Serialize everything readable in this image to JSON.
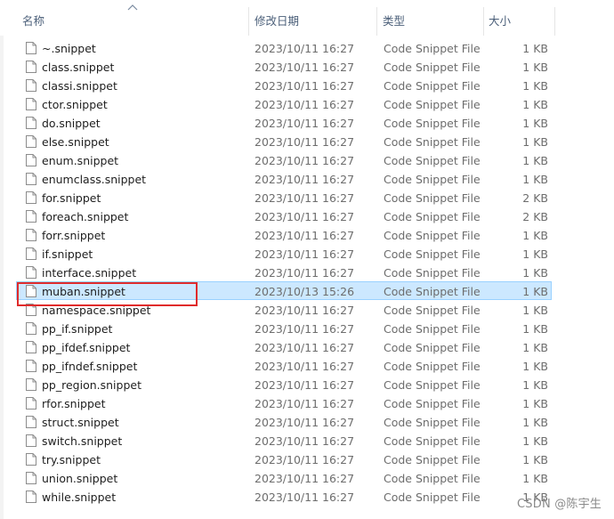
{
  "columns": {
    "name": "名称",
    "date": "修改日期",
    "type": "类型",
    "size": "大小"
  },
  "files": [
    {
      "name": "~.snippet",
      "date": "2023/10/11 16:27",
      "type": "Code Snippet File",
      "size": "1 KB"
    },
    {
      "name": "class.snippet",
      "date": "2023/10/11 16:27",
      "type": "Code Snippet File",
      "size": "1 KB"
    },
    {
      "name": "classi.snippet",
      "date": "2023/10/11 16:27",
      "type": "Code Snippet File",
      "size": "1 KB"
    },
    {
      "name": "ctor.snippet",
      "date": "2023/10/11 16:27",
      "type": "Code Snippet File",
      "size": "1 KB"
    },
    {
      "name": "do.snippet",
      "date": "2023/10/11 16:27",
      "type": "Code Snippet File",
      "size": "1 KB"
    },
    {
      "name": "else.snippet",
      "date": "2023/10/11 16:27",
      "type": "Code Snippet File",
      "size": "1 KB"
    },
    {
      "name": "enum.snippet",
      "date": "2023/10/11 16:27",
      "type": "Code Snippet File",
      "size": "1 KB"
    },
    {
      "name": "enumclass.snippet",
      "date": "2023/10/11 16:27",
      "type": "Code Snippet File",
      "size": "1 KB"
    },
    {
      "name": "for.snippet",
      "date": "2023/10/11 16:27",
      "type": "Code Snippet File",
      "size": "2 KB"
    },
    {
      "name": "foreach.snippet",
      "date": "2023/10/11 16:27",
      "type": "Code Snippet File",
      "size": "2 KB"
    },
    {
      "name": "forr.snippet",
      "date": "2023/10/11 16:27",
      "type": "Code Snippet File",
      "size": "1 KB"
    },
    {
      "name": "if.snippet",
      "date": "2023/10/11 16:27",
      "type": "Code Snippet File",
      "size": "1 KB"
    },
    {
      "name": "interface.snippet",
      "date": "2023/10/11 16:27",
      "type": "Code Snippet File",
      "size": "1 KB"
    },
    {
      "name": "muban.snippet",
      "date": "2023/10/13 15:26",
      "type": "Code Snippet File",
      "size": "1 KB",
      "selected": true
    },
    {
      "name": "namespace.snippet",
      "date": "2023/10/11 16:27",
      "type": "Code Snippet File",
      "size": "1 KB"
    },
    {
      "name": "pp_if.snippet",
      "date": "2023/10/11 16:27",
      "type": "Code Snippet File",
      "size": "1 KB"
    },
    {
      "name": "pp_ifdef.snippet",
      "date": "2023/10/11 16:27",
      "type": "Code Snippet File",
      "size": "1 KB"
    },
    {
      "name": "pp_ifndef.snippet",
      "date": "2023/10/11 16:27",
      "type": "Code Snippet File",
      "size": "1 KB"
    },
    {
      "name": "pp_region.snippet",
      "date": "2023/10/11 16:27",
      "type": "Code Snippet File",
      "size": "1 KB"
    },
    {
      "name": "rfor.snippet",
      "date": "2023/10/11 16:27",
      "type": "Code Snippet File",
      "size": "1 KB"
    },
    {
      "name": "struct.snippet",
      "date": "2023/10/11 16:27",
      "type": "Code Snippet File",
      "size": "1 KB"
    },
    {
      "name": "switch.snippet",
      "date": "2023/10/11 16:27",
      "type": "Code Snippet File",
      "size": "1 KB"
    },
    {
      "name": "try.snippet",
      "date": "2023/10/11 16:27",
      "type": "Code Snippet File",
      "size": "1 KB"
    },
    {
      "name": "union.snippet",
      "date": "2023/10/11 16:27",
      "type": "Code Snippet File",
      "size": "1 KB"
    },
    {
      "name": "while.snippet",
      "date": "2023/10/11 16:27",
      "type": "Code Snippet File",
      "size": "1 KB"
    }
  ],
  "watermark": "CSDN @陈宇生",
  "colors": {
    "selected_bg": "#cce8ff",
    "selected_border": "#99d1ff",
    "highlight_box": "#e02b2b",
    "header_text": "#4c607a",
    "detail_text": "#6d6d6d"
  },
  "icons": {
    "sort": "sort-ascending-icon",
    "file": "file-icon"
  }
}
